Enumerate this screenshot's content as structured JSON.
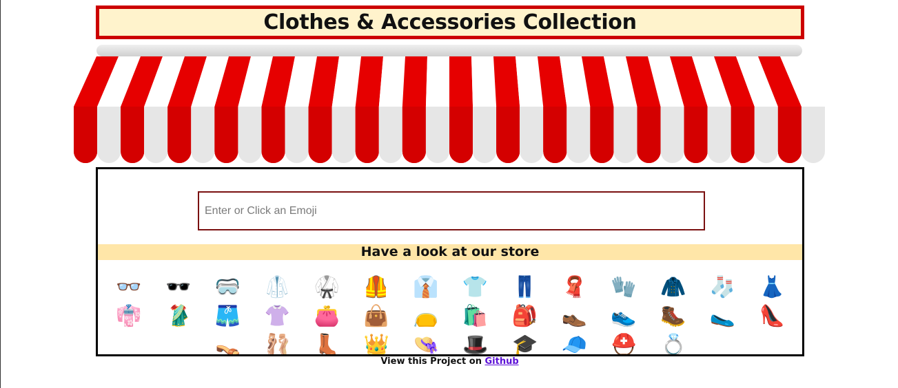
{
  "header": {
    "title": "Clothes & Accessories Collection"
  },
  "search": {
    "placeholder": "Enter or Click an Emoji",
    "value": ""
  },
  "store": {
    "heading": "Have a look at our store"
  },
  "emojis": [
    {
      "name": "glasses-emoji",
      "char": "👓"
    },
    {
      "name": "sunglasses-emoji",
      "char": "🕶️"
    },
    {
      "name": "goggles-emoji",
      "char": "🥽"
    },
    {
      "name": "lab-coat-emoji",
      "char": "🥼"
    },
    {
      "name": "martial-arts-uniform-emoji",
      "char": "🥋"
    },
    {
      "name": "safety-vest-emoji",
      "char": "🦺"
    },
    {
      "name": "necktie-emoji",
      "char": "👔"
    },
    {
      "name": "t-shirt-emoji",
      "char": "👕"
    },
    {
      "name": "jeans-emoji",
      "char": "👖"
    },
    {
      "name": "scarf-emoji",
      "char": "🧣"
    },
    {
      "name": "gloves-emoji",
      "char": "🧤"
    },
    {
      "name": "coat-emoji",
      "char": "🧥"
    },
    {
      "name": "socks-emoji",
      "char": "🧦"
    },
    {
      "name": "dress-emoji",
      "char": "👗"
    },
    {
      "name": "kimono-emoji",
      "char": "👘"
    },
    {
      "name": "sari-emoji",
      "char": "🥻"
    },
    {
      "name": "briefs-emoji",
      "char": "🩳"
    },
    {
      "name": "blouse-emoji",
      "char": "👚"
    },
    {
      "name": "purse-emoji",
      "char": "👛"
    },
    {
      "name": "handbag-emoji",
      "char": "👜"
    },
    {
      "name": "clutch-bag-emoji",
      "char": "👝"
    },
    {
      "name": "shopping-bags-emoji",
      "char": "🛍️"
    },
    {
      "name": "backpack-emoji",
      "char": "🎒"
    },
    {
      "name": "mans-shoe-emoji",
      "char": "👞"
    },
    {
      "name": "running-shoe-emoji",
      "char": "👟"
    },
    {
      "name": "hiking-boot-emoji",
      "char": "🥾"
    },
    {
      "name": "flat-shoe-emoji",
      "char": "🥿"
    },
    {
      "name": "high-heel-emoji",
      "char": "👠"
    },
    {
      "name": "sandal-emoji",
      "char": "👡"
    },
    {
      "name": "ballet-shoes-emoji",
      "char": "🩰"
    },
    {
      "name": "boot-emoji",
      "char": "👢"
    },
    {
      "name": "crown-emoji",
      "char": "👑"
    },
    {
      "name": "womans-hat-emoji",
      "char": "👒"
    },
    {
      "name": "top-hat-emoji",
      "char": "🎩"
    },
    {
      "name": "graduation-cap-emoji",
      "char": "🎓"
    },
    {
      "name": "billed-cap-emoji",
      "char": "🧢"
    },
    {
      "name": "rescue-helmet-emoji",
      "char": "⛑️"
    },
    {
      "name": "ring-emoji",
      "char": "💍"
    }
  ],
  "footer": {
    "text": "View this Project on ",
    "link_label": "Github"
  },
  "colors": {
    "title_border": "#cc0000",
    "title_bg": "#fff3cc",
    "banner_bg": "#ffe6a8",
    "awning_red": "#e60000"
  }
}
